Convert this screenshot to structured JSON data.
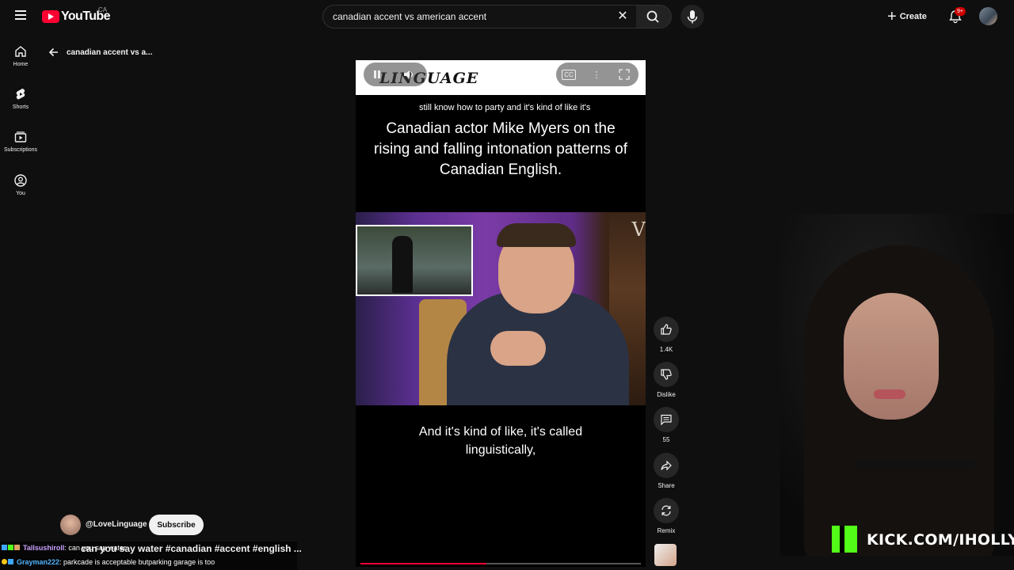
{
  "topbar": {
    "logo_text": "YouTube",
    "country": "CA",
    "search_value": "canadian accent vs american accent",
    "create_label": "Create",
    "notifications_badge": "9+"
  },
  "nav": {
    "items": [
      {
        "label": "Home",
        "icon": "home-icon"
      },
      {
        "label": "Shorts",
        "icon": "shorts-icon"
      },
      {
        "label": "Subscriptions",
        "icon": "subscriptions-icon"
      },
      {
        "label": "You",
        "icon": "you-icon"
      }
    ],
    "back_title": "canadian accent vs a..."
  },
  "video": {
    "brand": "LINGUAGE",
    "small_caption": "still know how to party and it's kind of like it's",
    "big_caption": "Canadian actor Mike Myers on the rising and falling intonation patterns of Canadian English.",
    "bottom_caption": "And it's kind of like, it's called linguistically,",
    "cc_label": "CC",
    "progress": 0.45
  },
  "actions": {
    "like_count": "1.4K",
    "dislike_label": "Dislike",
    "comments_count": "55",
    "share_label": "Share",
    "remix_label": "Remix"
  },
  "channel": {
    "handle": "@LoveLinguage",
    "subscribe_label": "Subscribe",
    "description": "can you say water #canadian #accent #english ..."
  },
  "chat": [
    {
      "user": "Tallsushiroll",
      "message": ": can you say water",
      "user_color": "#c8a2ff"
    },
    {
      "user": "Grayman222",
      "message": ": parkcade is acceptable butparking garage is too",
      "user_color": "#4fb3ff"
    }
  ],
  "stream": {
    "kick_text": "KICK.COM/IHOLLY",
    "kick_color": "#53fc18"
  }
}
